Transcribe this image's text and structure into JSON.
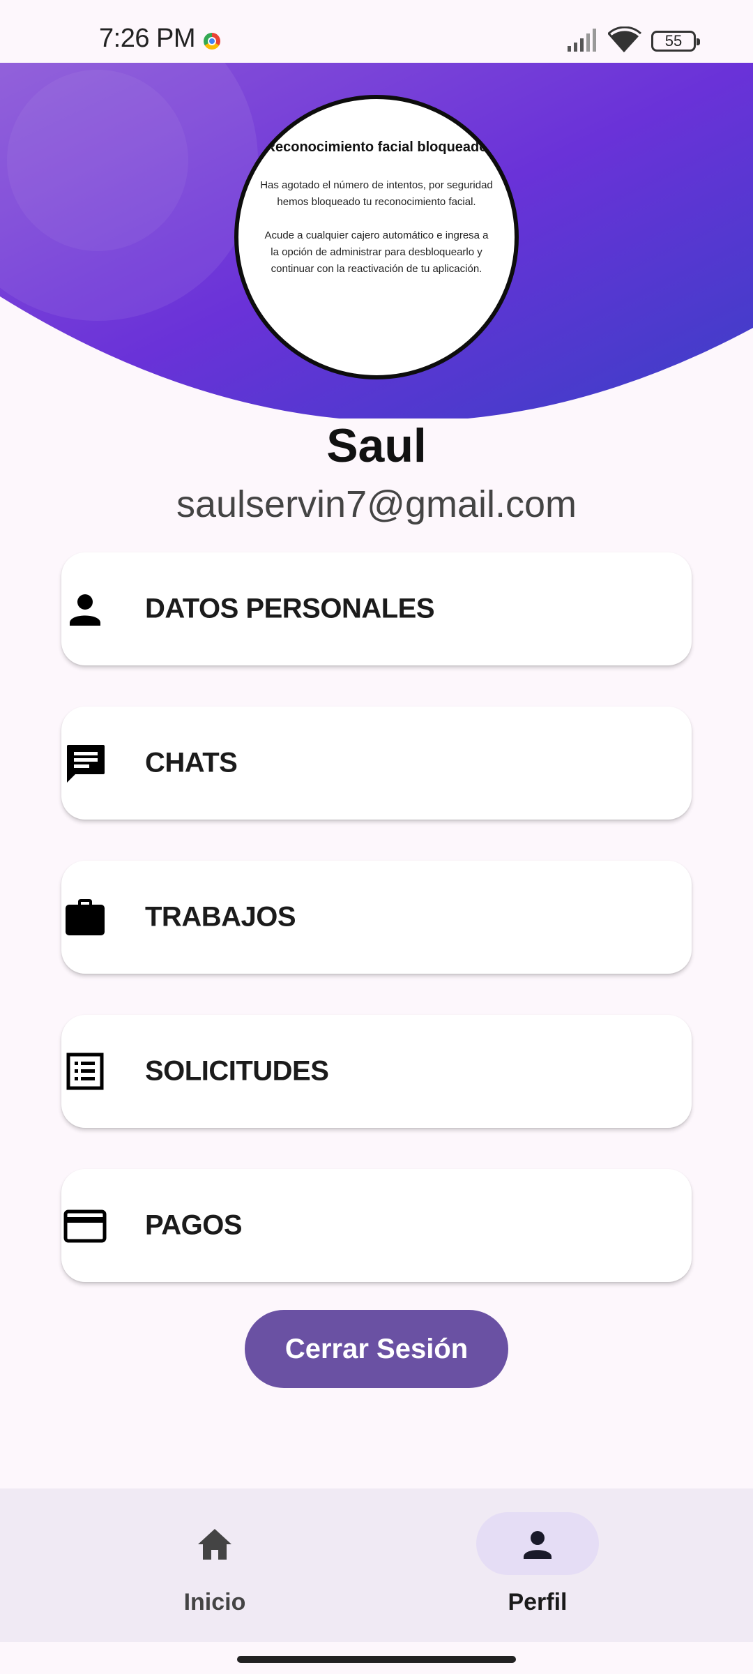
{
  "status_bar": {
    "time": "7:26 PM",
    "battery": "55"
  },
  "avatar_notice": {
    "title": "Reconocimiento facial bloqueado",
    "paragraph1": "Has agotado el número de intentos, por seguridad hemos bloqueado tu reconocimiento facial.",
    "paragraph2": "Acude a cualquier cajero automático e ingresa a la opción de administrar para desbloquearlo y continuar con la reactivación de tu aplicación."
  },
  "profile": {
    "name": "Saul",
    "email": "saulservin7@gmail.com"
  },
  "menu": [
    {
      "label": "DATOS PERSONALES",
      "icon": "person-icon"
    },
    {
      "label": "CHATS",
      "icon": "chat-icon"
    },
    {
      "label": "TRABAJOS",
      "icon": "briefcase-icon"
    },
    {
      "label": "SOLICITUDES",
      "icon": "list-icon"
    },
    {
      "label": "PAGOS",
      "icon": "credit-card-icon"
    }
  ],
  "logout_label": "Cerrar Sesión",
  "bottom_nav": [
    {
      "label": "Inicio",
      "icon": "home-icon",
      "active": false
    },
    {
      "label": "Perfil",
      "icon": "person-icon",
      "active": true
    }
  ],
  "colors": {
    "header_gradient_start": "#8a55d8",
    "header_gradient_end": "#3a3fc6",
    "accent": "#6a51a3",
    "background": "#fdf7fc",
    "nav_background": "#f0eaf4",
    "nav_active_pill": "#e5ddf5"
  }
}
